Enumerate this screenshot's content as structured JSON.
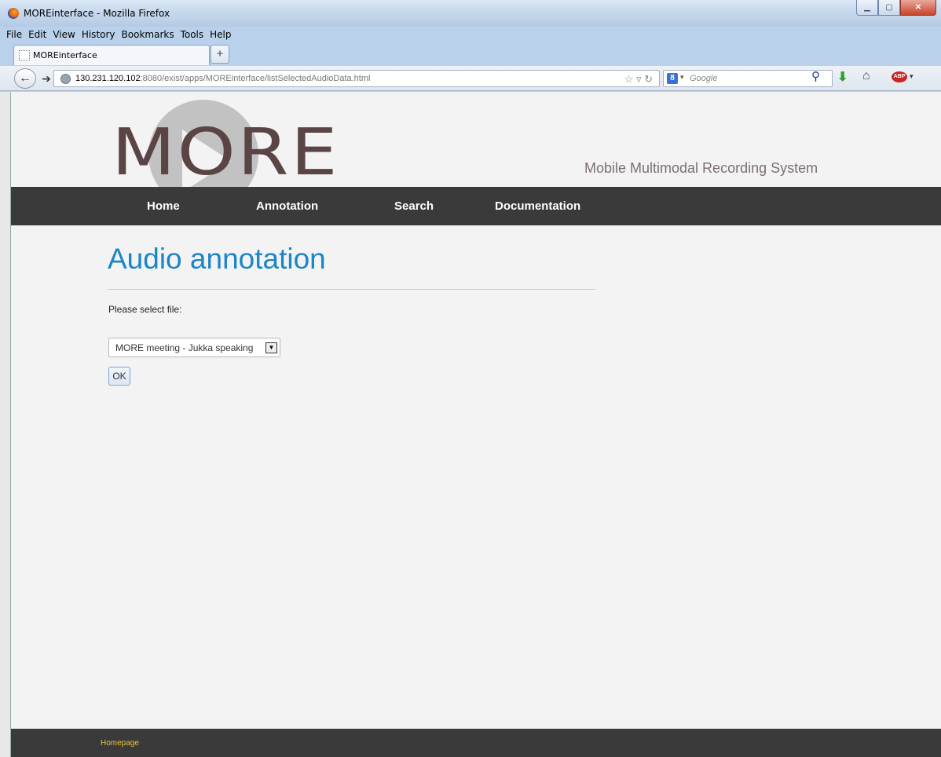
{
  "window": {
    "title": "MOREinterface - Mozilla Firefox"
  },
  "menu": [
    "File",
    "Edit",
    "View",
    "History",
    "Bookmarks",
    "Tools",
    "Help"
  ],
  "tab": {
    "title": "MOREinterface",
    "new_tab": "+"
  },
  "address": {
    "host": "130.231.120.102",
    "rest": ":8080/exist/apps/MOREinterface/listSelectedAudioData.html"
  },
  "search": {
    "placeholder": "Google"
  },
  "site": {
    "logo": "MORE",
    "tagline": "Mobile Multimodal Recording System",
    "nav": [
      "Home",
      "Annotation",
      "Search",
      "Documentation"
    ]
  },
  "main": {
    "heading": "Audio annotation",
    "prompt": "Please select file:",
    "selected_file": "MORE meeting - Jukka speaking",
    "ok_label": "OK"
  },
  "footer": {
    "link": "Homepage"
  },
  "colors": {
    "heading": "#1a85c7",
    "nav_bg": "#3a3a3a",
    "footer_link": "#e6c23a"
  }
}
